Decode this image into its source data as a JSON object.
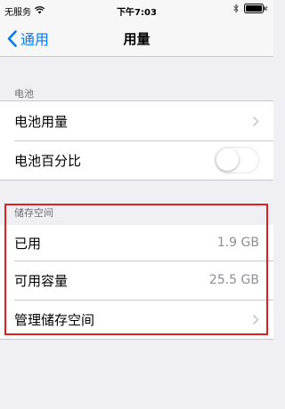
{
  "status_bar": {
    "carrier": "无服务",
    "time": "下午7:03"
  },
  "nav": {
    "back_label": "通用",
    "title": "用量"
  },
  "battery_section": {
    "header": "电池",
    "usage_label": "电池用量",
    "percentage_label": "电池百分比",
    "percentage_on": false
  },
  "storage_section": {
    "header": "储存空间",
    "used_label": "已用",
    "used_value": "1.9 GB",
    "available_label": "可用容量",
    "available_value": "25.5 GB",
    "manage_label": "管理储存空间"
  },
  "colors": {
    "accent": "#007aff",
    "highlight": "#e02020"
  }
}
